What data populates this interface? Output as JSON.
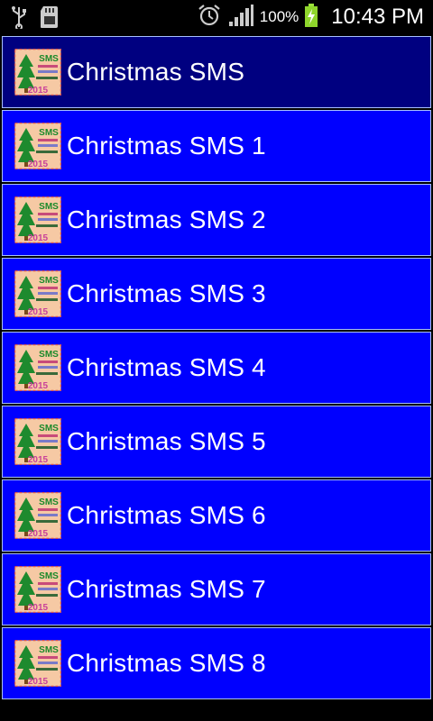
{
  "status_bar": {
    "battery_percent": "100%",
    "time": "10:43 PM",
    "icons": [
      "usb-icon",
      "sd-card-icon",
      "alarm-icon",
      "signal-icon",
      "battery-charging-icon"
    ]
  },
  "list": {
    "items": [
      {
        "label": "Christmas SMS",
        "selected": true
      },
      {
        "label": "Christmas SMS 1",
        "selected": false
      },
      {
        "label": "Christmas SMS 2",
        "selected": false
      },
      {
        "label": "Christmas SMS 3",
        "selected": false
      },
      {
        "label": "Christmas SMS 4",
        "selected": false
      },
      {
        "label": "Christmas SMS 5",
        "selected": false
      },
      {
        "label": "Christmas SMS 6",
        "selected": false
      },
      {
        "label": "Christmas SMS 7",
        "selected": false
      },
      {
        "label": "Christmas SMS 8",
        "selected": false
      }
    ],
    "thumb_text": {
      "top": "SMS",
      "bottom": "2015"
    }
  },
  "colors": {
    "row_bg": "#0000ff",
    "row_selected_bg": "#000080",
    "status_bg": "#000000"
  }
}
